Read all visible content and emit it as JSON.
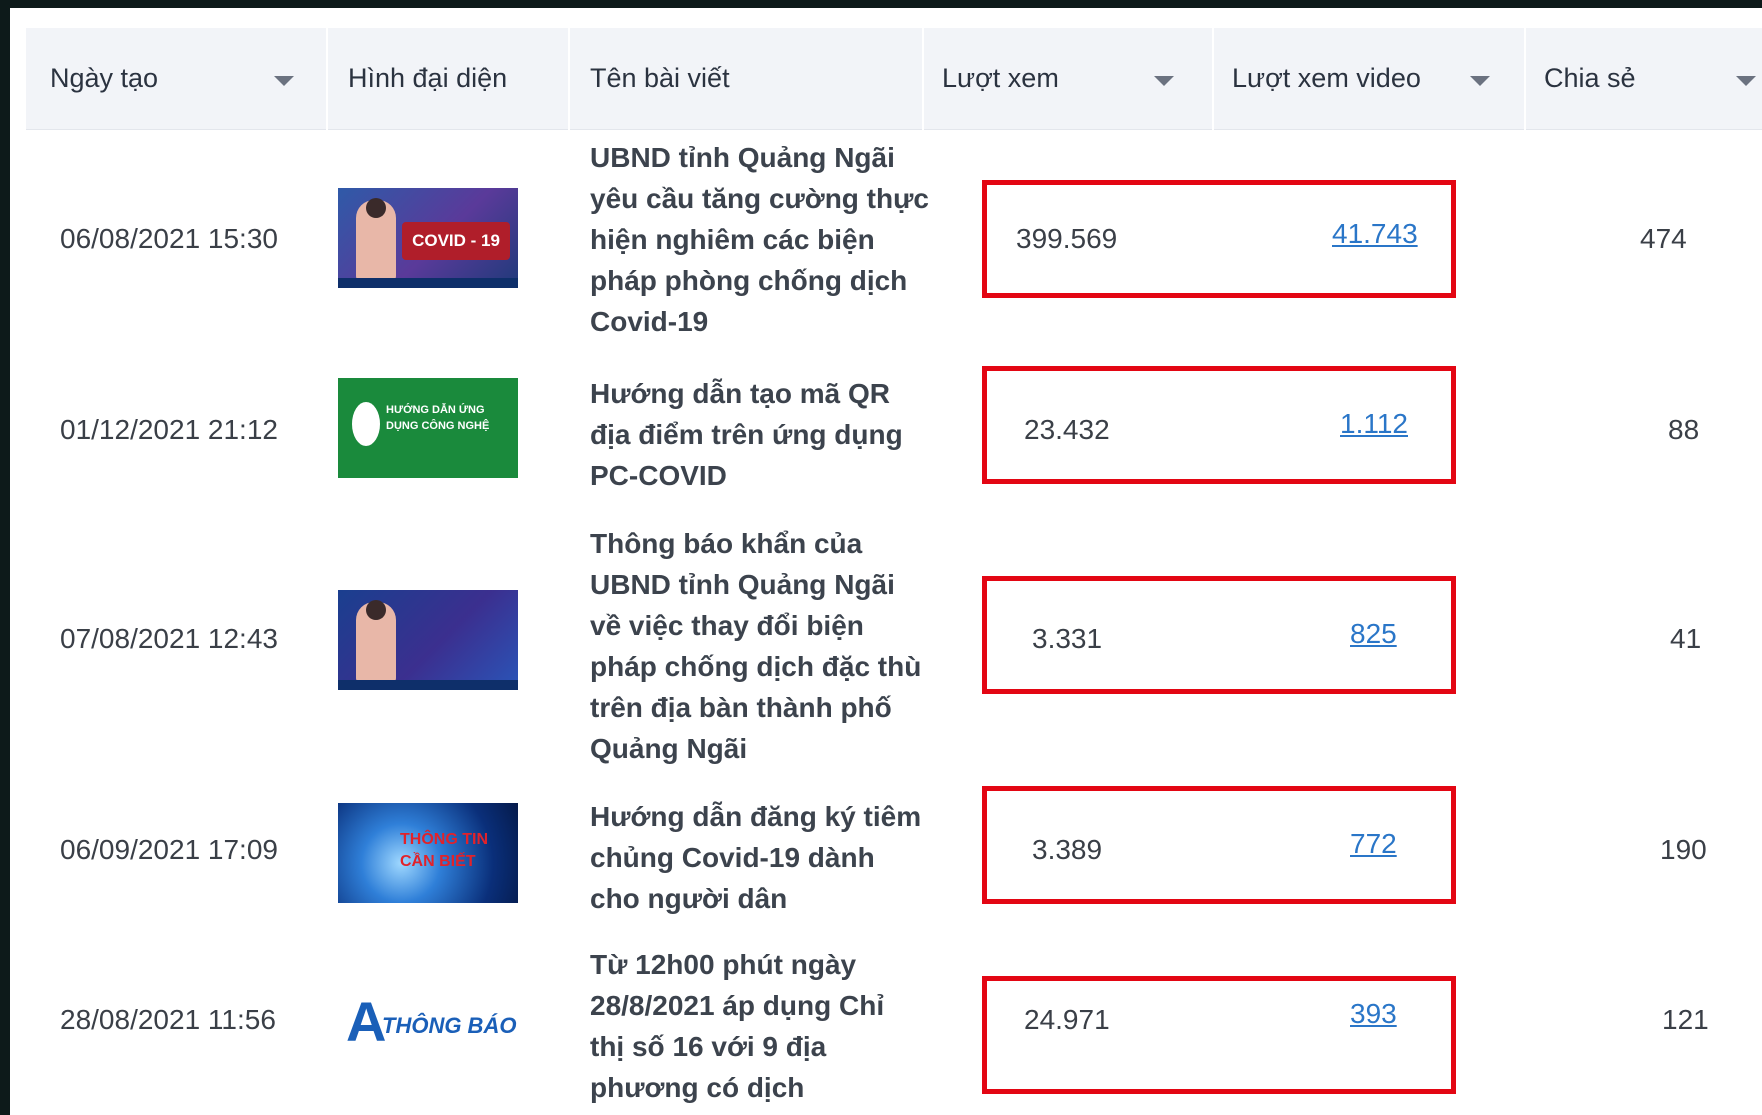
{
  "columns": {
    "created_date": "Ngày tạo",
    "thumbnail": "Hình đại diện",
    "article_title": "Tên bài viết",
    "views": "Lượt xem",
    "video_views": "Lượt xem video",
    "shares": "Chia sẻ"
  },
  "rows": [
    {
      "date": "06/08/2021 15:30",
      "thumbnail_icon": "covid-video-thumbnail",
      "thumbnail_caption": "COVID - 19",
      "title_lines": [
        "UBND tỉnh Quảng Ngãi",
        "yêu cầu tăng cường thực",
        "hiện nghiêm các biện",
        "pháp phòng chống dịch",
        "Covid-19"
      ],
      "views": "399.569",
      "video_views": "41.743",
      "shares": "474"
    },
    {
      "date": "01/12/2021 21:12",
      "thumbnail_icon": "tech-guide-thumbnail",
      "thumbnail_caption": "HƯỚNG DẪN ỨNG DỤNG CÔNG NGHỆ",
      "title_lines": [
        "Hướng dẫn tạo mã QR",
        "địa điểm trên ứng dụng",
        "PC-COVID"
      ],
      "views": "23.432",
      "video_views": "1.112",
      "shares": "88"
    },
    {
      "date": "07/08/2021 12:43",
      "thumbnail_icon": "news-video-thumbnail",
      "thumbnail_caption": "",
      "title_lines": [
        "Thông báo khẩn của",
        "UBND tỉnh Quảng Ngãi",
        "về việc thay đổi biện",
        "pháp chống dịch đặc thù",
        "trên địa bàn thành phố",
        "Quảng Ngãi"
      ],
      "views": "3.331",
      "video_views": "825",
      "shares": "41"
    },
    {
      "date": "06/09/2021 17:09",
      "thumbnail_icon": "globe-news-thumbnail",
      "thumbnail_caption": "THÔNG TIN CẦN BIẾT",
      "title_lines": [
        "Hướng dẫn đăng ký tiêm",
        "chủng Covid-19 dành",
        "cho người dân"
      ],
      "views": "3.389",
      "video_views": "772",
      "shares": "190"
    },
    {
      "date": "28/08/2021 11:56",
      "thumbnail_icon": "announcement-thumbnail",
      "thumbnail_caption": "THÔNG BÁO",
      "title_lines": [
        "Từ 12h00 phút ngày",
        "28/8/2021 áp dụng Chỉ",
        "thị số 16 với 9 địa",
        "phương có dịch"
      ],
      "views": "24.971",
      "video_views": "393",
      "shares": "121"
    }
  ],
  "highlight_color": "#e30613",
  "link_color": "#2a76c8"
}
